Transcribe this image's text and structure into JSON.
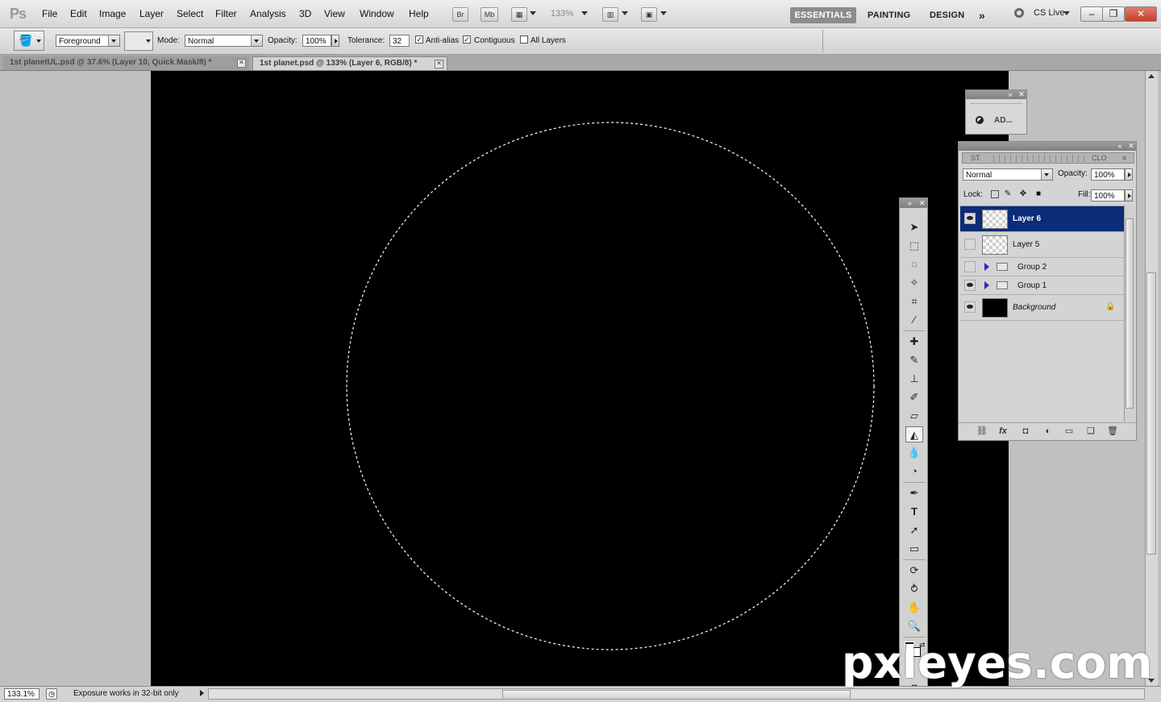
{
  "app": {
    "logo": "Ps"
  },
  "menu": [
    "File",
    "Edit",
    "Image",
    "Layer",
    "Select",
    "Filter",
    "Analysis",
    "3D",
    "View",
    "Window",
    "Help"
  ],
  "appbar": {
    "bridge": "Br",
    "minibridge": "Mb",
    "zoom": "133%"
  },
  "workspaces": {
    "essentials": "ESSENTIALS",
    "painting": "PAINTING",
    "design": "DESIGN",
    "more": "»"
  },
  "cslive": "CS Live",
  "window_controls": {
    "minimize": "–",
    "restore": "❐",
    "close": "✕"
  },
  "options": {
    "fill_source": "Foreground",
    "mode_label": "Mode:",
    "mode": "Normal",
    "opacity_label": "Opacity:",
    "opacity": "100%",
    "tolerance_label": "Tolerance:",
    "tolerance": "32",
    "antialias_label": "Anti-alias",
    "antialias": true,
    "contiguous_label": "Contiguous",
    "contiguous": true,
    "all_layers_label": "All Layers",
    "all_layers": false
  },
  "tabs": [
    {
      "label": "1st planetUL.psd @ 37.6% (Layer 10, Quick Mask/8) *",
      "active": false
    },
    {
      "label": "1st planet.psd @ 133% (Layer 6, RGB/8) *",
      "active": true
    }
  ],
  "status": {
    "zoom": "133.1%",
    "message": "Exposure works in 32-bit only"
  },
  "adjustments_panel": {
    "label": "AD..."
  },
  "layers_panel": {
    "tabs": [
      "ST.",
      "CLO"
    ],
    "blend_mode": "Normal",
    "opacity_label": "Opacity:",
    "opacity": "100%",
    "lock_label": "Lock:",
    "fill_label": "Fill:",
    "fill": "100%",
    "layers": [
      {
        "name": "Layer 6",
        "visible": true,
        "selected": true,
        "kind": "layer"
      },
      {
        "name": "Layer 5",
        "visible": false,
        "selected": false,
        "kind": "layer"
      },
      {
        "name": "Group 2",
        "visible": false,
        "selected": false,
        "kind": "group"
      },
      {
        "name": "Group 1",
        "visible": true,
        "selected": false,
        "kind": "group"
      },
      {
        "name": "Background",
        "visible": true,
        "selected": false,
        "kind": "background"
      }
    ]
  },
  "tools": [
    "move-tool-icon",
    "marquee-tool-icon",
    "lasso-tool-icon",
    "quick-selection-tool-icon",
    "crop-tool-icon",
    "eyedropper-tool-icon",
    "healing-brush-tool-icon",
    "brush-tool-icon",
    "clone-stamp-tool-icon",
    "history-brush-tool-icon",
    "eraser-tool-icon",
    "paint-bucket-tool-icon",
    "blur-tool-icon",
    "dodge-tool-icon",
    "pen-tool-icon",
    "type-tool-icon",
    "path-selection-tool-icon",
    "rectangle-tool-icon",
    "3d-rotate-tool-icon",
    "3d-orbit-tool-icon",
    "hand-tool-icon",
    "zoom-tool-icon"
  ],
  "watermark": "pxleyes.com"
}
